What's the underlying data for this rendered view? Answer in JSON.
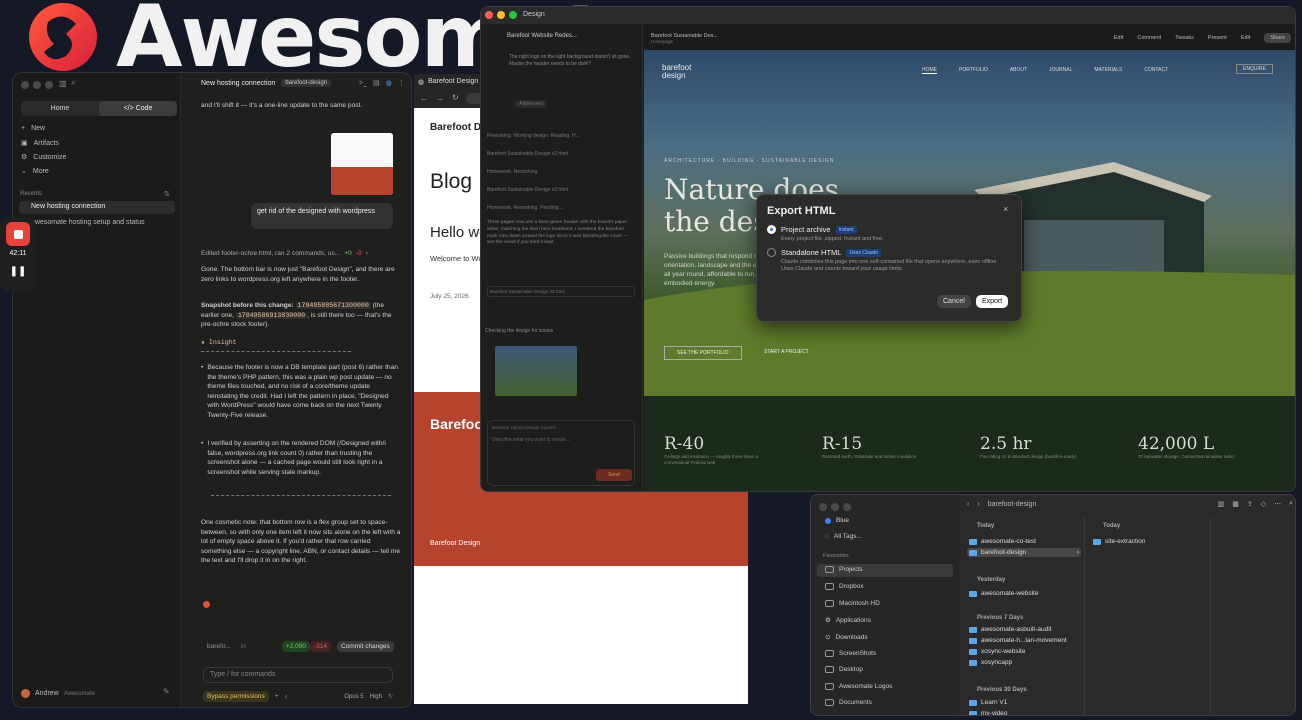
{
  "logo": {
    "text": "Awesomat"
  },
  "claude": {
    "segments": {
      "home": "Home",
      "code": "Code"
    },
    "nav": [
      "New",
      "Artifacts",
      "Customize",
      "More"
    ],
    "recents_label": "Recents",
    "recents": [
      "New hosting connection",
      "awesomate hosting setup and status"
    ],
    "account": {
      "name": "Andrew",
      "org": "Awesomate"
    },
    "header": {
      "title": "New hosting connection",
      "tag": "barefoot-design"
    },
    "prev_text": "and I'll shift it — it's a one-line update to the same post.",
    "user_msg": "get rid of the designed with wordpress",
    "tool_line": "Edited footer-ochre.html, ran 2 commands, us...",
    "tool_diff_add": "+0",
    "tool_diff_del": "-0",
    "p1": "Gone. The bottom bar is now just \"Barefoot Design\", and there are zero links to wordpress.org left anywhere in the footer.",
    "p2_a": "Snapshot before this change:",
    "p2_code1": "178495885671300000",
    "p2_b": "(the earlier one,",
    "p2_code2": "17849586913830000",
    "p2_c": ", is still there too — that's the pre-ochre stock footer).",
    "insight": "★ Insight",
    "b1": "Because the footer is now a DB template part (post 6) rather than the theme's PHP pattern, this was a plain wp post update — no theme files touched, and no risk of a core/theme update reinstating the credit. Had I left the pattern in place, \"Designed with WordPress\" would have come back on the next Twenty Twenty-Five release.",
    "b2": "I verified by asserting on the rendered DOM (/Designed with/i false, wordpress.org link count 0) rather than trusting the screenshot alone — a cached page would still look right in a screenshot while serving stale markup.",
    "p3": "One cosmetic note: that bottom row is a flex group set to space-between, so with only one item left it now sits alone on the left with a lot of empty space above it. If you'd rather that row carried something else — a copyright line, ABN, or contact details — tell me the text and I'll drop it in on the right.",
    "branch": "barefo...",
    "in": "in",
    "diff_add": "+2,090",
    "diff_del": "-314",
    "commit": "Commit changes",
    "input_placeholder": "Type / for commands",
    "bypass": "Bypass permissions",
    "model": "Opus 5",
    "effort": "High"
  },
  "recorder": {
    "time": "42:11"
  },
  "browser": {
    "tab": "Barefoot Design",
    "site_title": "Barefoot Design",
    "blog_heading": "Blog",
    "post_title": "Hello world!",
    "post_excerpt": "Welcome to WordPress. This is your first post. Edit or delete it, then start writing!",
    "date": "July 25, 2026",
    "footer_brand": "Barefoot Design",
    "footer_text": "Barefoot Design"
  },
  "design": {
    "window_title": "Design",
    "project_name": "Barefoot Website Redes...",
    "page_name": "Barefoot Sustainable Des...",
    "page_sub": "Homepage",
    "toolbar": [
      "Edit",
      "Comment",
      "Tweaks",
      "Present",
      "Edit",
      "Share"
    ],
    "sidebar_question": "The right logo on the light background doesn't sit gone. Maybe the header needs to be dark?",
    "sidebar_answer": "Addressed",
    "sidebar_items": [
      "Reworking. Working design. Reading. H...",
      "Barefoot Sustainable Design v2.html",
      "Homework. Reworking.",
      "Barefoot Sustainable Design v2.html",
      "Homework. Reworking. Pending..."
    ],
    "sidebar_para": "Three pages now use a linen-green header with the brand's paper white, matching the linen hero treatment. I centered the Barefoot mark now down around the logo since it was blending the cover — see the result if you tried it kept.",
    "sidebar_file": "Barefoot Sustainable Design 02.html",
    "sidebar_caption": "Checking the design for issues",
    "sidebar_input_label": "Barefoot Hybrid Design System",
    "sidebar_input_placeholder": "Describe what you want to create...",
    "sidebar_send": "Send",
    "nav_brand": "barefoot design",
    "nav": [
      "HOME",
      "PORTFOLIO",
      "ABOUT",
      "JOURNAL",
      "MATERIALS",
      "CONTACT"
    ],
    "nav_cta": "ENQUIRE",
    "eyebrow": "ARCHITECTURE · BUILDING · SUSTAINABLE DESIGN",
    "hero_title": "Nature does the design.",
    "hero_body": "Passive buildings that respond to climate, orientation, landscape and the earth — comfortable all year round, affordable to run, and built with low embodied energy.",
    "cta1": "SEE THE PORTFOLIO",
    "cta2": "START A PROJECT",
    "stats": [
      {
        "n": "R-40",
        "l": "Ceilings and insulation — roughly three times a conventional Federal wall"
      },
      {
        "n": "R-15",
        "l": "Rammed earth, strawbale and timber insulation"
      },
      {
        "n": "2.5 hr",
        "l": "Fire rating on a standard design (bushfire-ready)"
      },
      {
        "n": "42,000 L",
        "l": "Of rainwater storage. Connected rainwater tanks"
      }
    ]
  },
  "modal": {
    "title": "Export HTML",
    "opt1_label": "Project archive",
    "opt1_badge": "Instant",
    "opt1_desc": "Every project file, zipped. Instant and free.",
    "opt2_label": "Standalone HTML",
    "opt2_badge": "Uses Claude",
    "opt2_desc": "Claude combines this page into one self-contained file that opens anywhere, even offline. Uses Claude and counts toward your usage limits.",
    "cancel": "Cancel",
    "export": "Export"
  },
  "finder": {
    "path": "barefoot-design",
    "sidebar": [
      {
        "label": "Blue",
        "icon": "tag-icon"
      },
      {
        "label": "All Tags...",
        "icon": "tag-icon"
      }
    ],
    "favourites_label": "Favourites",
    "favourites": [
      "Projects",
      "Dropbox",
      "Macintosh HD",
      "Applications",
      "Downloads",
      "ScreenShots",
      "Desktop",
      "Awesomate Logos",
      "Documents"
    ],
    "col1_groups": [
      {
        "label": "Today",
        "items": [
          "awesomate-co-test",
          "barefoot-design"
        ]
      },
      {
        "label": "Yesterday",
        "items": [
          "awesomate-website"
        ]
      },
      {
        "label": "Previous 7 Days",
        "items": [
          "awesomate-asbuilt-audit",
          "awesomate-h...lan-movement",
          "xosync-website",
          "xosyncapp"
        ]
      },
      {
        "label": "Previous 30 Days",
        "items": [
          "Learn V1",
          "my-video"
        ]
      }
    ],
    "col2_label": "Today",
    "col2_items": [
      "site-extraction"
    ]
  },
  "colors": {
    "accent": "#c96442",
    "footer_red": "#b5432e",
    "blue": "#2f6fe0"
  }
}
